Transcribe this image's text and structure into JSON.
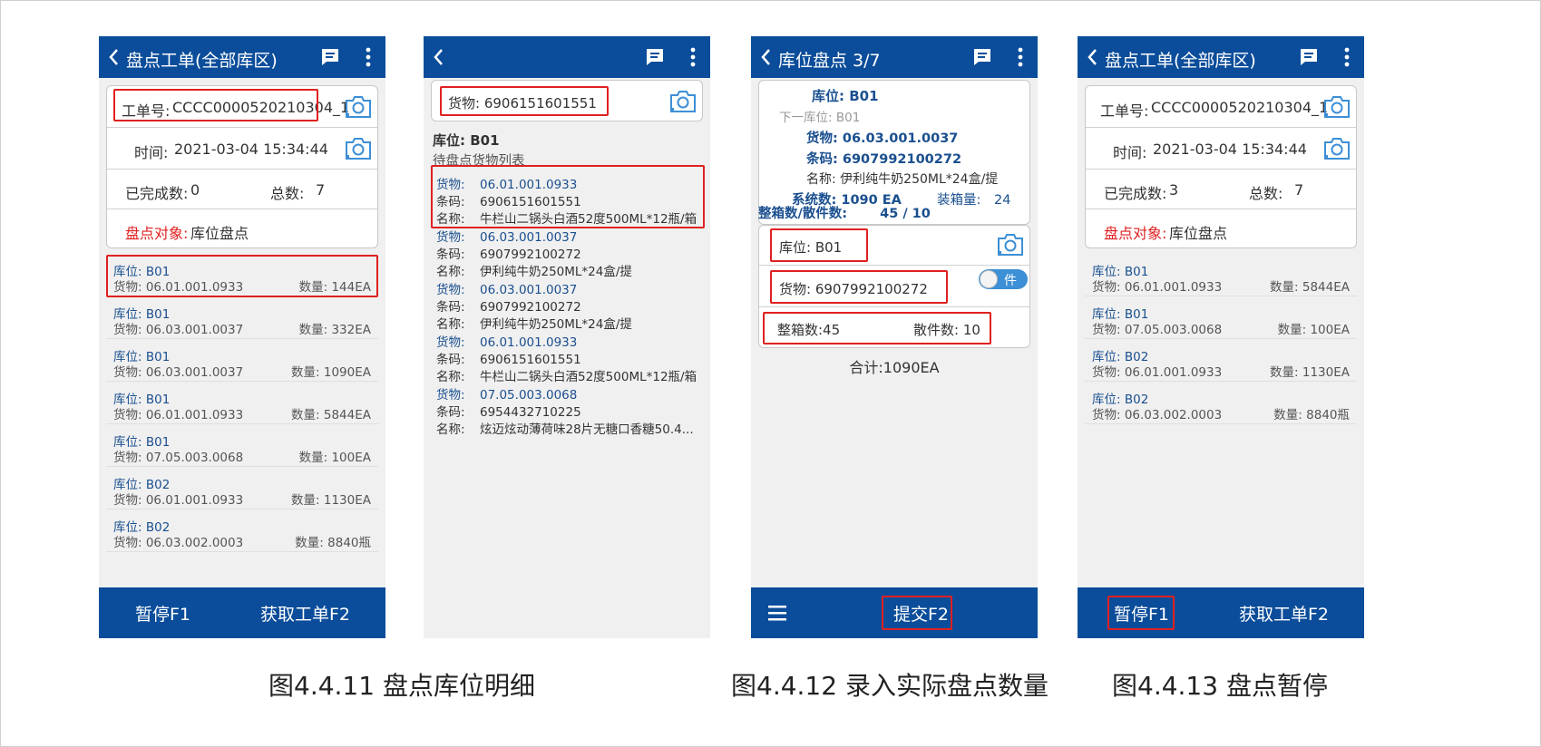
{
  "screen1": {
    "title": "盘点工单(全部库区)",
    "order_label": "工单号:",
    "order_value": "CCCC0000520210304_1",
    "time_label": "时间:",
    "time_value": "2021-03-04 15:34:44",
    "done_label": "已完成数:",
    "done_value": "0",
    "total_label": "总数:",
    "total_value": "7",
    "target_label": "盘点对象:",
    "target_value": "库位盘点",
    "items": [
      {
        "loc": "库位: B01",
        "goods": "货物: 06.01.001.0933",
        "qty": "数量: 144EA"
      },
      {
        "loc": "库位: B01",
        "goods": "货物: 06.03.001.0037",
        "qty": "数量: 332EA"
      },
      {
        "loc": "库位: B01",
        "goods": "货物: 06.03.001.0037",
        "qty": "数量: 1090EA"
      },
      {
        "loc": "库位: B01",
        "goods": "货物: 06.01.001.0933",
        "qty": "数量: 5844EA"
      },
      {
        "loc": "库位: B01",
        "goods": "货物: 07.05.003.0068",
        "qty": "数量: 100EA"
      },
      {
        "loc": "库位: B02",
        "goods": "货物: 06.01.001.0933",
        "qty": "数量: 1130EA"
      },
      {
        "loc": "库位: B02",
        "goods": "货物: 06.03.002.0003",
        "qty": "数量: 8840瓶"
      }
    ],
    "btn_pause": "暂停F1",
    "btn_fetch": "获取工单F2"
  },
  "screen2": {
    "goods_input": "货物: 6906151601551",
    "loc_label": "库位:",
    "loc_value": "B01",
    "list_title": "待盘点货物列表",
    "k_goods": "货物:",
    "k_code": "条码:",
    "k_name": "名称:",
    "goods": [
      {
        "goods": "06.01.001.0933",
        "code": "6906151601551",
        "name": "牛栏山二锅头白酒52度500ML*12瓶/箱"
      },
      {
        "goods": "06.03.001.0037",
        "code": "6907992100272",
        "name": "伊利纯牛奶250ML*24盒/提"
      },
      {
        "goods": "06.03.001.0037",
        "code": "6907992100272",
        "name": "伊利纯牛奶250ML*24盒/提"
      },
      {
        "goods": "06.01.001.0933",
        "code": "6906151601551",
        "name": "牛栏山二锅头白酒52度500ML*12瓶/箱"
      },
      {
        "goods": "07.05.003.0068",
        "code": "6954432710225",
        "name": "炫迈炫动薄荷味28片无糖口香糖50.4..."
      }
    ]
  },
  "screen3": {
    "title": "库位盘点  3/7",
    "loc_label": "库位:",
    "loc_value": "B01",
    "next_loc": "下一库位: B01",
    "goods_label": "货物:",
    "goods_value": "06.03.001.0037",
    "code_label": "条码:",
    "code_value": "6907992100272",
    "name_label": "名称:",
    "name_value": "伊利纯牛奶250ML*24盒/提",
    "sys_label": "系统数:",
    "sys_value": "1090  EA",
    "pack_label": "装箱量:",
    "pack_value": "24",
    "box_label": "整箱数/散件数:",
    "box_value": "45  /  10",
    "input_loc": "库位: B01",
    "input_goods": "货物: 6907992100272",
    "toggle_label": "件",
    "box_input": "整箱数:45",
    "piece_input": "散件数: 10",
    "total": "合计:1090EA",
    "btn_submit": "提交F2"
  },
  "screen4": {
    "title": "盘点工单(全部库区)",
    "order_label": "工单号:",
    "order_value": "CCCC0000520210304_1",
    "time_label": "时间:",
    "time_value": "2021-03-04 15:34:44",
    "done_label": "已完成数:",
    "done_value": "3",
    "total_label": "总数:",
    "total_value": "7",
    "target_label": "盘点对象:",
    "target_value": "库位盘点",
    "items": [
      {
        "loc": "库位: B01",
        "goods": "货物: 06.01.001.0933",
        "qty": "数量: 5844EA"
      },
      {
        "loc": "库位: B01",
        "goods": "货物: 07.05.003.0068",
        "qty": "数量: 100EA"
      },
      {
        "loc": "库位: B02",
        "goods": "货物: 06.01.001.0933",
        "qty": "数量: 1130EA"
      },
      {
        "loc": "库位: B02",
        "goods": "货物: 06.03.002.0003",
        "qty": "数量: 8840瓶"
      }
    ],
    "btn_pause": "暂停F1",
    "btn_fetch": "获取工单F2"
  },
  "captions": {
    "c1": "图4.4.11 盘点库位明细",
    "c2": "图4.4.12 录入实际盘点数量",
    "c3": "图4.4.13 盘点暂停"
  },
  "colors": {
    "appbar": "#0b4d9a",
    "highlight": "#e02020",
    "accent_text": "#1a4f8f"
  }
}
